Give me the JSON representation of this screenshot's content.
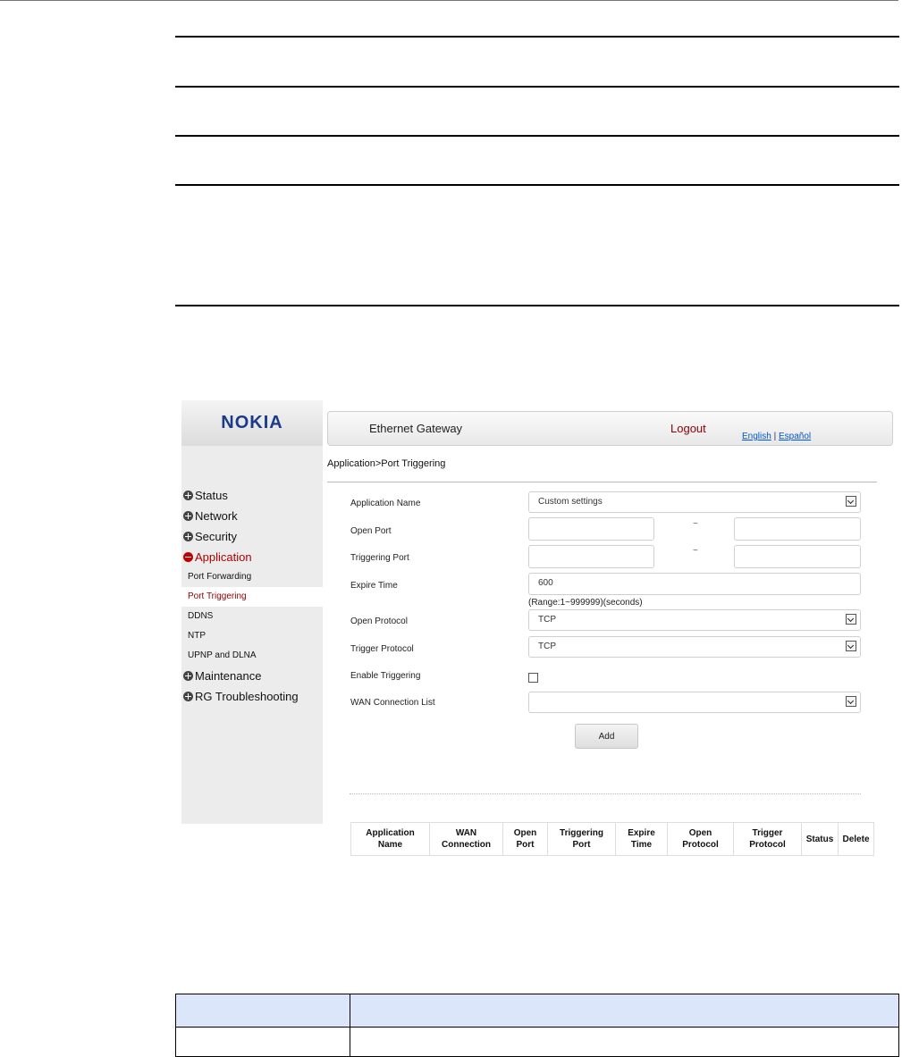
{
  "gateway": {
    "logo": "NOKIA",
    "title": "Ethernet Gateway",
    "logout": "Logout",
    "lang_english": "English",
    "lang_separator": "|",
    "lang_espanol": "Español",
    "breadcrumb": "Application>Port Triggering"
  },
  "menu": {
    "status": "Status",
    "network": "Network",
    "security": "Security",
    "application": "Application",
    "sub": {
      "port_forwarding": "Port Forwarding",
      "port_triggering": "Port Triggering",
      "ddns": "DDNS",
      "ntp": "NTP",
      "upnp": "UPNP and DLNA"
    },
    "maintenance": "Maintenance",
    "rg_troubleshooting": "RG Troubleshooting"
  },
  "form": {
    "application_name_label": "Application Name",
    "application_name_value": "Custom settings",
    "open_port_label": "Open Port",
    "triggering_port_label": "Triggering Port",
    "range_sep": "~",
    "expire_time_label": "Expire Time",
    "expire_time_value": "600",
    "expire_range": "(Range:1~999999)(seconds)",
    "open_protocol_label": "Open Protocol",
    "open_protocol_value": "TCP",
    "trigger_protocol_label": "Trigger Protocol",
    "trigger_protocol_value": "TCP",
    "enable_triggering_label": "Enable Triggering",
    "enable_triggering_checked": false,
    "wan_connection_label": "WAN Connection List",
    "wan_connection_value": "",
    "add_button": "Add"
  },
  "rules_table": {
    "headers": [
      "Application\nName",
      "WAN\nConnection",
      "Open\nPort",
      "Triggering\nPort",
      "Expire\nTime",
      "Open\nProtocol",
      "Trigger\nProtocol",
      "Status",
      "Delete"
    ]
  }
}
